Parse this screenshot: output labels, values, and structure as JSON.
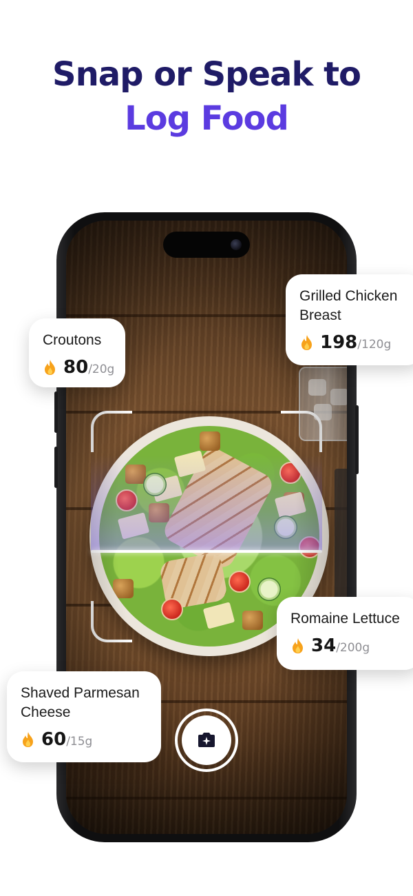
{
  "headline": {
    "line1": "Snap or Speak to",
    "line2": "Log Food"
  },
  "foods": [
    {
      "name": "Croutons",
      "calories": "80",
      "portion": "/20g"
    },
    {
      "name": "Grilled Chicken Breast",
      "calories": "198",
      "portion": "/120g"
    },
    {
      "name": "Romaine Lettuce",
      "calories": "34",
      "portion": "/200g"
    },
    {
      "name": "Shaved Parmesan Cheese",
      "calories": "60",
      "portion": "/15g"
    }
  ],
  "icons": {
    "calorie": "flame-icon",
    "shutter": "camera-sparkle-icon"
  },
  "colors": {
    "headline_dark": "#1f1b66",
    "headline_accent": "#5b3be0",
    "flame": "#f7a21b",
    "scan_tint": "#8a74ff"
  }
}
